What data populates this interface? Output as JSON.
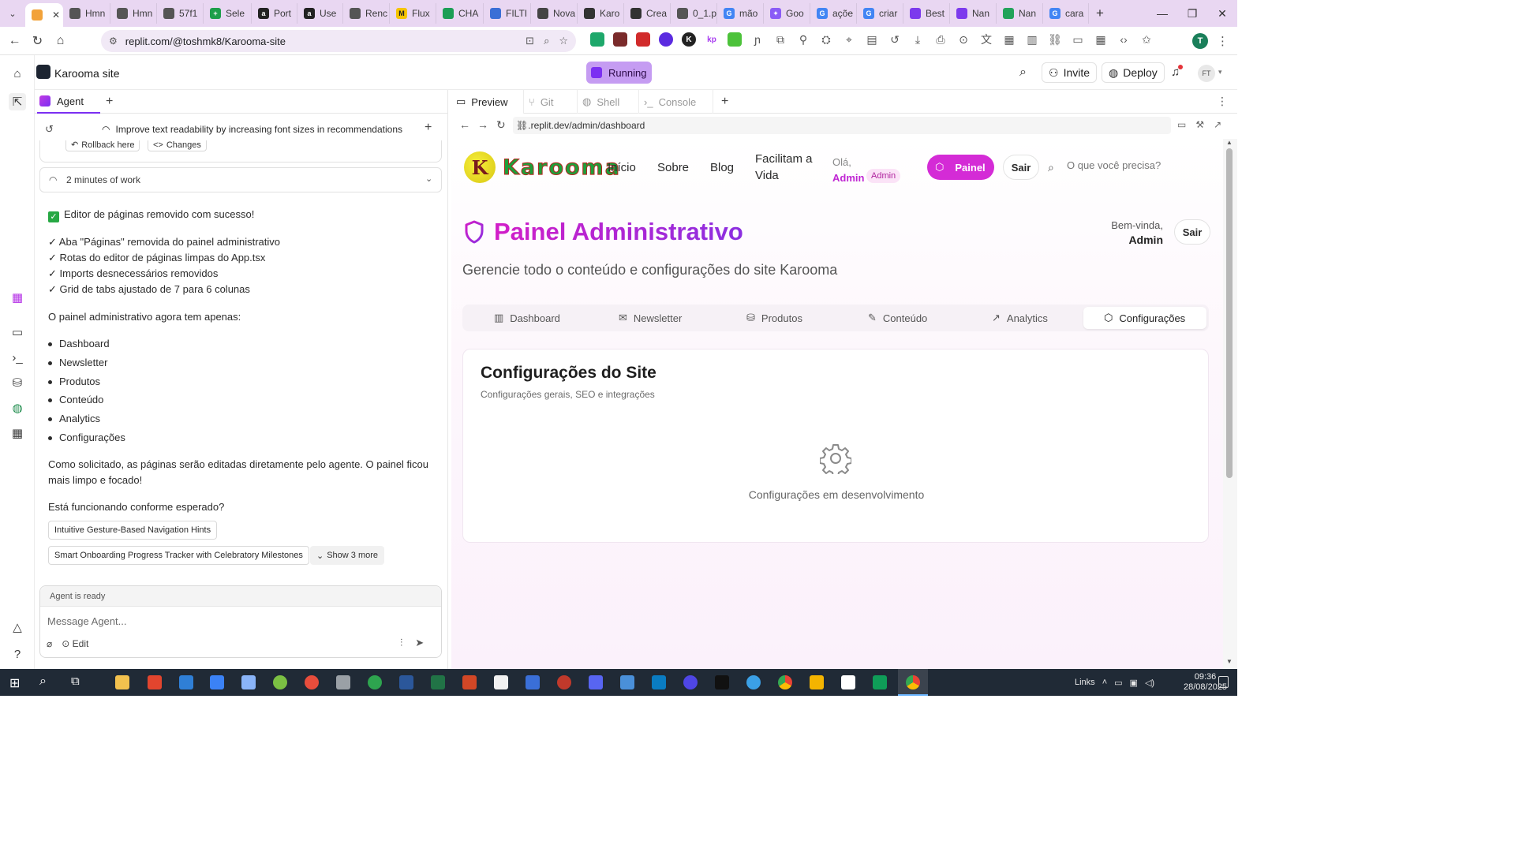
{
  "browser": {
    "tabs": [
      {
        "label": "",
        "active": true,
        "color": "#f2a23a"
      },
      {
        "label": "Hmn",
        "color": "#555555"
      },
      {
        "label": "Hmn",
        "color": "#555555"
      },
      {
        "label": "57f1",
        "color": "#555555"
      },
      {
        "label": "Sele",
        "color": "#1e9e4a"
      },
      {
        "label": "Port",
        "color": "#222222"
      },
      {
        "label": "Use",
        "color": "#222222"
      },
      {
        "label": "Renc",
        "color": "#555555"
      },
      {
        "label": "Flux",
        "color": "#f5c400"
      },
      {
        "label": "CHA",
        "color": "#1b9e55"
      },
      {
        "label": "FILTI",
        "color": "#3b6fd6"
      },
      {
        "label": "Nova",
        "color": "#444444"
      },
      {
        "label": "Karo",
        "color": "#333333"
      },
      {
        "label": "Crea",
        "color": "#333333"
      },
      {
        "label": "0_1.p",
        "color": "#555555"
      },
      {
        "label": "mão",
        "color": "#4285f4"
      },
      {
        "label": "Goo",
        "color": "#8b5cf6"
      },
      {
        "label": "açõe",
        "color": "#4285f4"
      },
      {
        "label": "criar",
        "color": "#4285f4"
      },
      {
        "label": "Best",
        "color": "#7c3aed"
      },
      {
        "label": "Nan",
        "color": "#7c3aed"
      },
      {
        "label": "Nan",
        "color": "#22a35a"
      },
      {
        "label": "cara",
        "color": "#4285f4"
      }
    ],
    "url": "replit.com/@toshmk8/Karooma-site",
    "profile_initial": "T"
  },
  "replit": {
    "project_name": "Karooma site",
    "run_status": "Running",
    "invite_label": "Invite",
    "deploy_label": "Deploy",
    "avatar_initials": "FT"
  },
  "agent": {
    "tab_label": "Agent",
    "history_title": "Improve text readability by increasing font sizes in recommendations",
    "rollback_label": "Rollback here",
    "changes_label": "Changes",
    "work_time": "2 minutes of work",
    "success_line": "Editor de páginas removido com sucesso!",
    "checks": [
      "✓ Aba \"Páginas\" removida do painel administrativo",
      "✓ Rotas do editor de páginas limpas do App.tsx",
      "✓ Imports desnecessários removidos",
      "✓ Grid de tabs ajustado de 7 para 6 colunas"
    ],
    "list_intro": "O painel administrativo agora tem apenas:",
    "list_items": [
      "Dashboard",
      "Newsletter",
      "Produtos",
      "Conteúdo",
      "Analytics",
      "Configurações"
    ],
    "closing_line1": "Como solicitado, as páginas serão editadas diretamente pelo agente. O painel ficou",
    "closing_line2": "mais limpo e focado!",
    "question": "Está funcionando conforme esperado?",
    "suggestions": [
      "Intuitive Gesture-Based Navigation Hints",
      "Smart Onboarding Progress Tracker with Celebratory Milestones"
    ],
    "show_more": "Show 3 more",
    "status": "Agent is ready",
    "input_placeholder": "Message Agent...",
    "edit_label": "Edit"
  },
  "preview": {
    "tabs": [
      "Preview",
      "Git",
      "Shell",
      "Console"
    ],
    "url": ".replit.dev/admin/dashboard"
  },
  "site": {
    "logo_text": "Karooma",
    "nav": [
      "Início",
      "Sobre",
      "Blog",
      "Facilitam a",
      "Vida"
    ],
    "greeting": "Olá,",
    "user_name": "Admin",
    "user_badge": "Admin",
    "panel_button": "Painel",
    "logout_button": "Sair",
    "search_placeholder": "O que você precisa?",
    "dashboard_title": "Painel Administrativo",
    "welcome": "Bem-vinda,",
    "welcome_name": "Admin",
    "welcome_logout": "Sair",
    "subtitle": "Gerencie todo o conteúdo e configurações do site Karooma",
    "admin_tabs": [
      "Dashboard",
      "Newsletter",
      "Produtos",
      "Conteúdo",
      "Analytics",
      "Configurações"
    ],
    "active_tab": "Configurações",
    "card_title": "Configurações do Site",
    "card_subtitle": "Configurações gerais, SEO e integrações",
    "empty_state": "Configurações em desenvolvimento"
  },
  "taskbar": {
    "links_label": "Links",
    "time": "09:36",
    "date": "28/08/2025"
  },
  "colors": {
    "accent_purple": "#7b2ff2",
    "brand_magenta": "#d42bd6",
    "running_bg": "#c59cf2",
    "tabstrip_bg": "#e9d7f2"
  }
}
